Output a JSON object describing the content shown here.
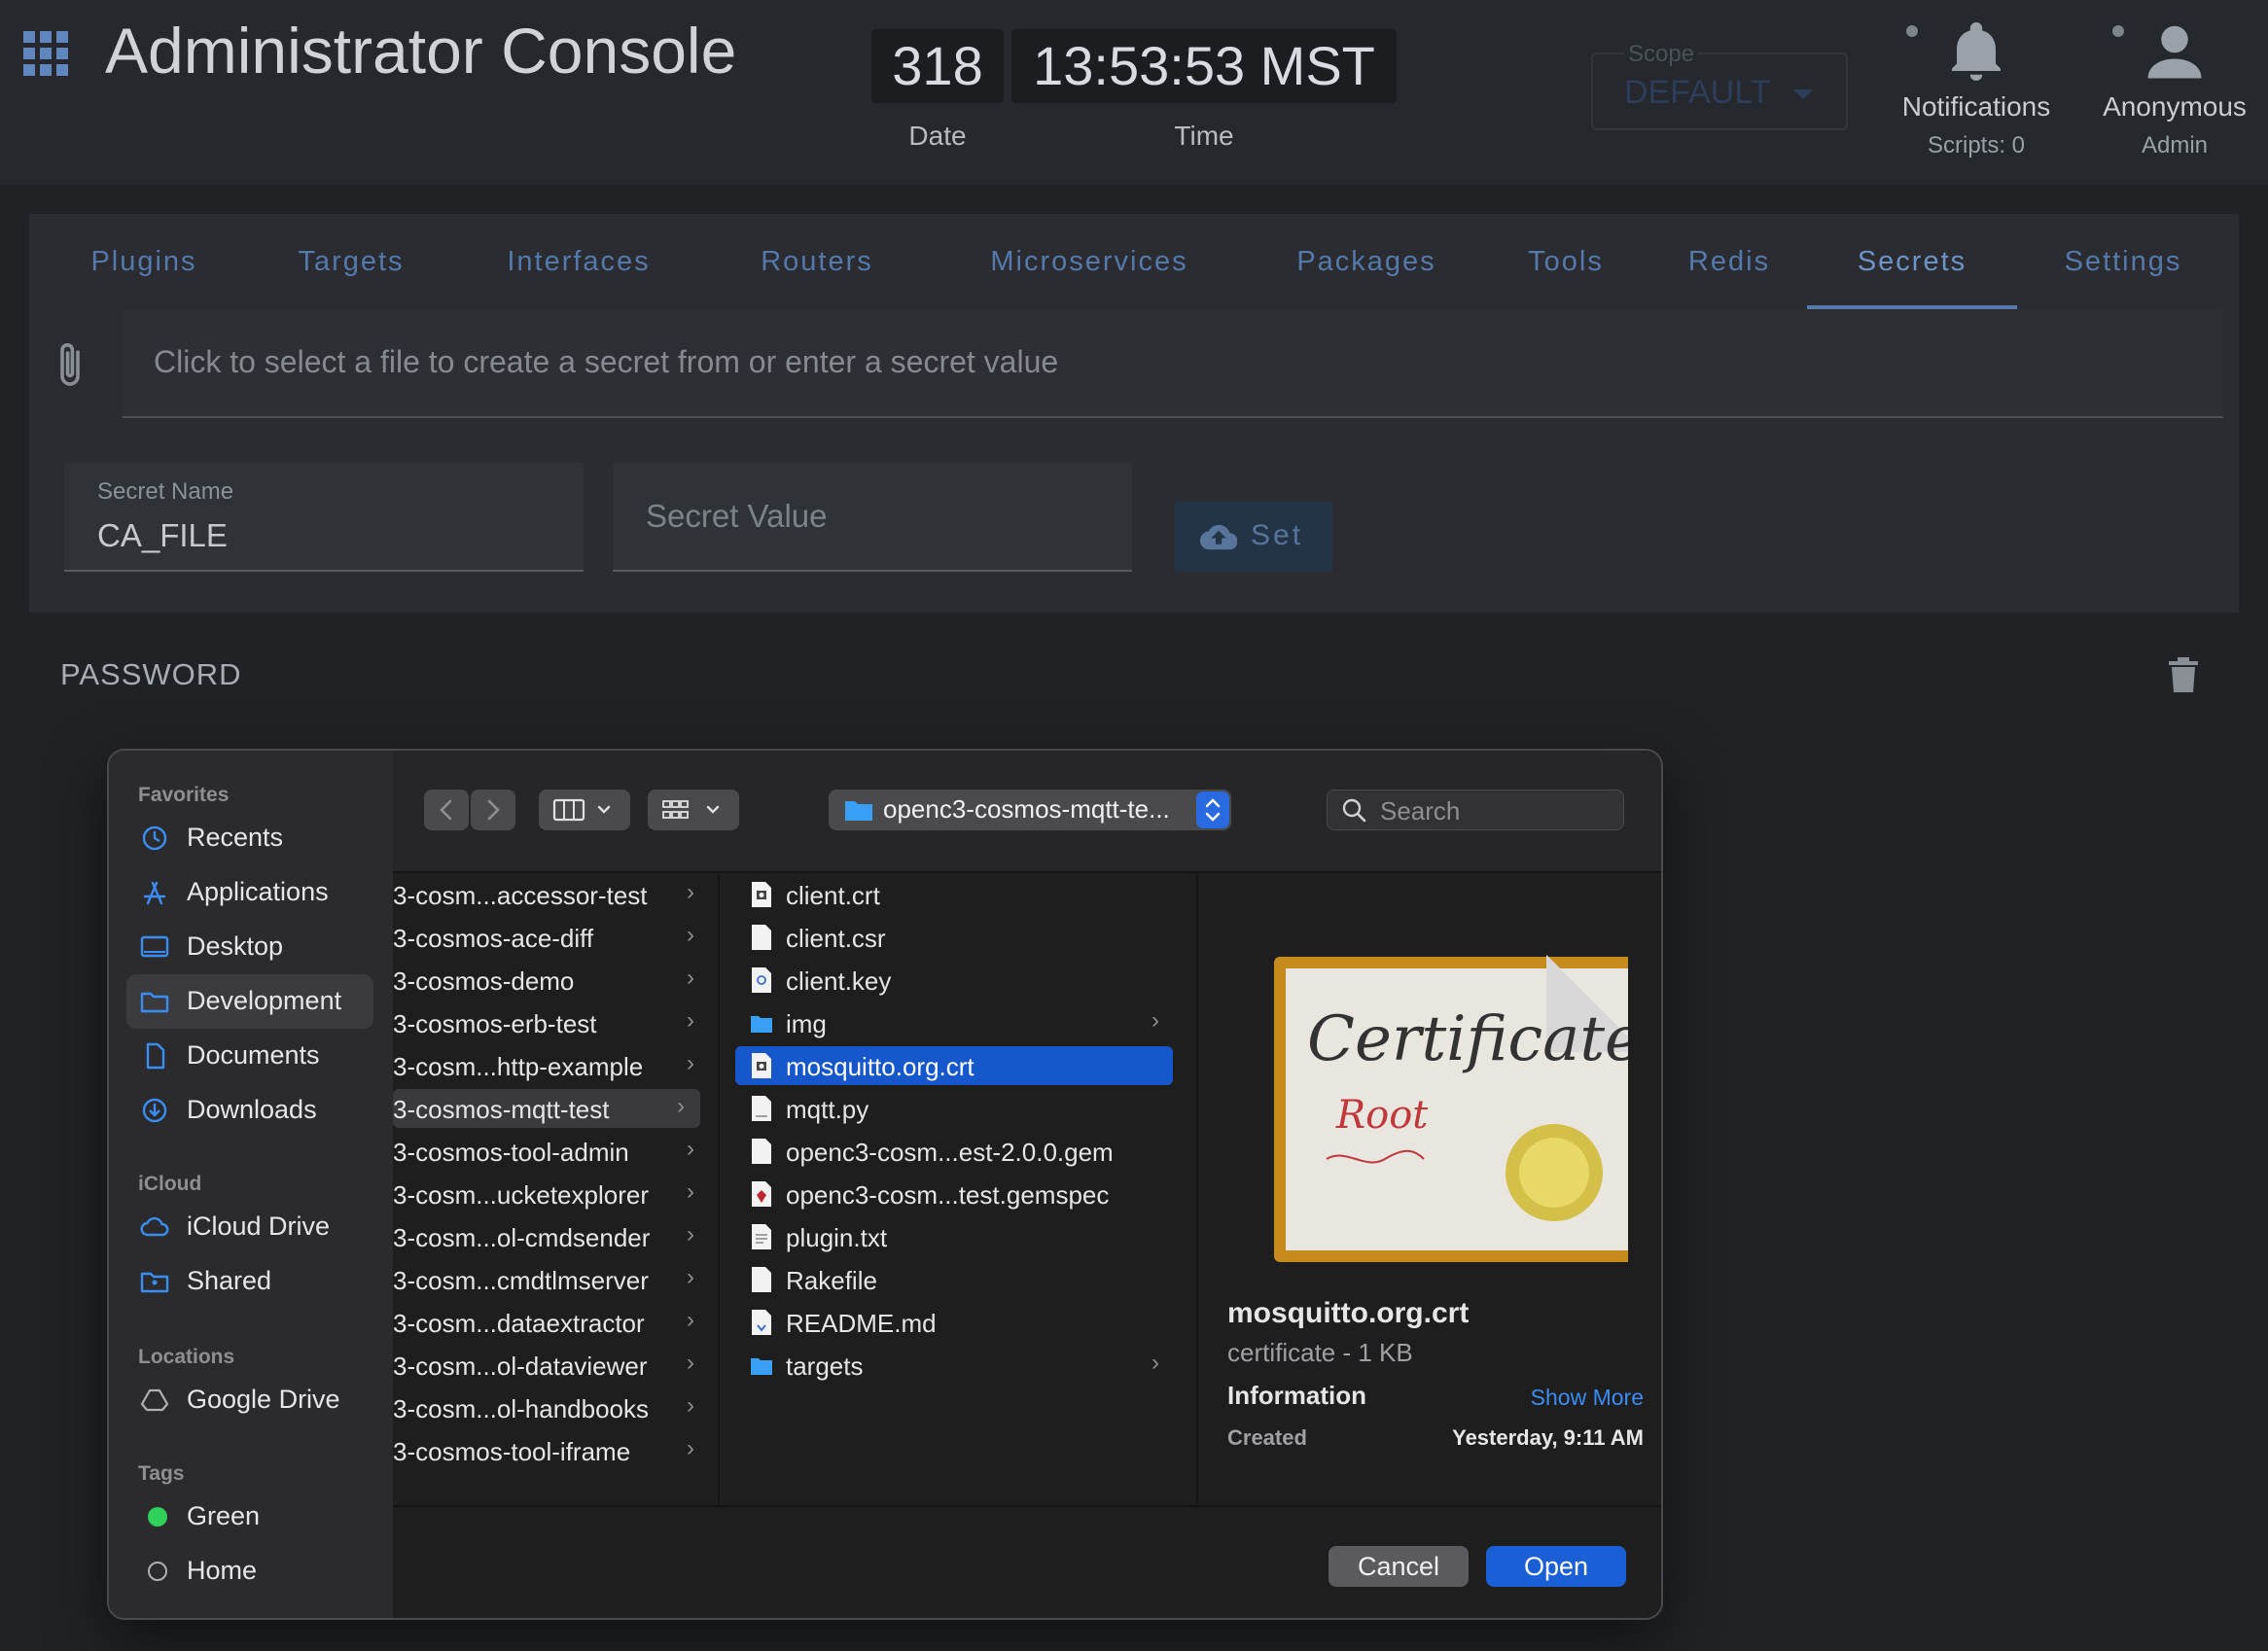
{
  "app": {
    "title": "Administrator Console",
    "date_value": "318",
    "date_label": "Date",
    "time_value": "13:53:53 MST",
    "time_label": "Time",
    "scope_label": "Scope",
    "scope_value": "DEFAULT",
    "notifications_label": "Notifications",
    "notifications_sub": "Scripts: 0",
    "user_label": "Anonymous",
    "user_sub": "Admin"
  },
  "tabs": [
    "Plugins",
    "Targets",
    "Interfaces",
    "Routers",
    "Microservices",
    "Packages",
    "Tools",
    "Redis",
    "Secrets",
    "Settings"
  ],
  "secrets": {
    "file_placeholder": "Click to select a file to create a secret from or enter a secret value",
    "name_label": "Secret Name",
    "name_value": "CA_FILE",
    "value_placeholder": "Secret Value",
    "set_label": "Set",
    "existing": [
      "PASSWORD"
    ]
  },
  "dialog": {
    "sidebar": {
      "favorites_header": "Favorites",
      "favorites": [
        "Recents",
        "Applications",
        "Desktop",
        "Development",
        "Documents",
        "Downloads"
      ],
      "icloud_header": "iCloud",
      "icloud": [
        "iCloud Drive",
        "Shared"
      ],
      "locations_header": "Locations",
      "locations": [
        "Google Drive"
      ],
      "tags_header": "Tags",
      "tags": [
        {
          "name": "Green",
          "color": "#30d158"
        },
        {
          "name": "Home",
          "color": ""
        }
      ]
    },
    "path": "openc3-cosmos-mqtt-te...",
    "search_placeholder": "Search",
    "column1": [
      "3-cosm...accessor-test",
      "3-cosmos-ace-diff",
      "3-cosmos-demo",
      "3-cosmos-erb-test",
      "3-cosm...http-example",
      "3-cosmos-mqtt-test",
      "3-cosmos-tool-admin",
      "3-cosm...ucketexplorer",
      "3-cosm...ol-cmdsender",
      "3-cosm...cmdtlmserver",
      "3-cosm...dataextractor",
      "3-cosm...ol-dataviewer",
      "3-cosm...ol-handbooks",
      "3-cosmos-tool-iframe"
    ],
    "column2": [
      {
        "name": "client.crt",
        "type": "cert"
      },
      {
        "name": "client.csr",
        "type": "doc"
      },
      {
        "name": "client.key",
        "type": "key"
      },
      {
        "name": "img",
        "type": "folder"
      },
      {
        "name": "mosquitto.org.crt",
        "type": "cert"
      },
      {
        "name": "mqtt.py",
        "type": "doc"
      },
      {
        "name": "openc3-cosm...est-2.0.0.gem",
        "type": "doc"
      },
      {
        "name": "openc3-cosm...test.gemspec",
        "type": "gem"
      },
      {
        "name": "plugin.txt",
        "type": "txt"
      },
      {
        "name": "Rakefile",
        "type": "doc"
      },
      {
        "name": "README.md",
        "type": "md"
      },
      {
        "name": "targets",
        "type": "folder"
      }
    ],
    "preview": {
      "cert_word": "Certificate",
      "cert_sub": "Root",
      "filename": "mosquitto.org.crt",
      "kind": "certificate - 1 KB",
      "info_label": "Information",
      "show_more": "Show More",
      "created_label": "Created",
      "created_value": "Yesterday, 9:11 AM"
    },
    "cancel_label": "Cancel",
    "open_label": "Open"
  }
}
